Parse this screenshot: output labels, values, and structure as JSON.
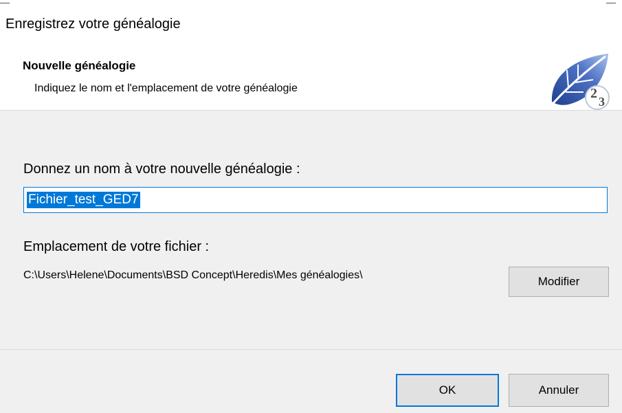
{
  "window": {
    "title": "Enregistrez votre généalogie"
  },
  "header": {
    "title": "Nouvelle généalogie",
    "subtitle": "Indiquez le nom et l'emplacement de votre généalogie",
    "logo_text": "23"
  },
  "form": {
    "name_label": "Donnez un nom à votre nouvelle généalogie :",
    "name_value": "Fichier_test_GED7",
    "location_label": "Emplacement de votre fichier :",
    "location_path": "C:\\Users\\Helene\\Documents\\BSD Concept\\Heredis\\Mes généalogies\\",
    "modify_label": "Modifier"
  },
  "footer": {
    "ok_label": "OK",
    "cancel_label": "Annuler"
  },
  "colors": {
    "accent": "#0078d7",
    "dialog_bg": "#f0f0f0",
    "button_bg": "#e1e1e1",
    "logo_blue": "#2f4f9f"
  },
  "icons": {
    "logo": "heredis-leaf-logo"
  }
}
